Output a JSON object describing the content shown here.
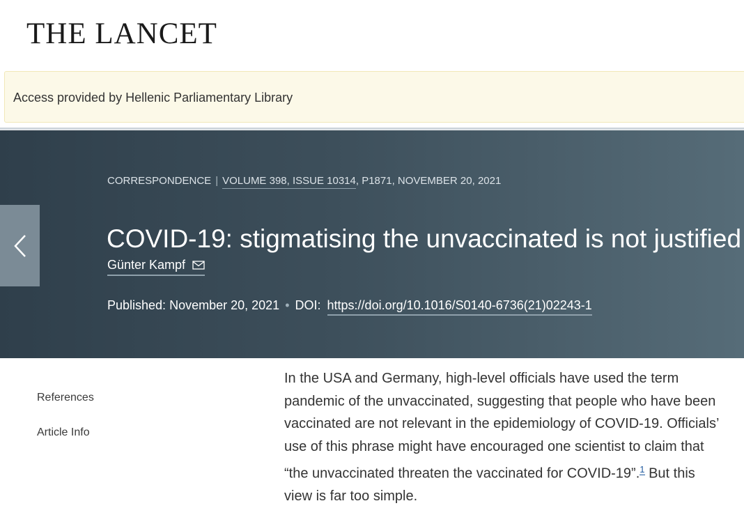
{
  "header": {
    "logo": "THE LANCET"
  },
  "access_banner": {
    "text": "Access provided by Hellenic Parliamentary Library"
  },
  "article": {
    "section": "CORRESPONDENCE",
    "volume_info": "VOLUME 398, ISSUE 10314",
    "page_date": ", P1871, NOVEMBER 20, 2021",
    "title": "COVID-19: stigmatising the unvaccinated is not justified",
    "author": "Günter Kampf",
    "published_label": "Published:",
    "published_date": "November 20, 2021",
    "doi_label": "DOI:",
    "doi_link": "https://doi.org/10.1016/S0140-6736(21)02243-1"
  },
  "sidebar": {
    "items": [
      {
        "label": "References"
      },
      {
        "label": "Article Info"
      }
    ]
  },
  "body": {
    "paragraph": "In the USA and Germany, high-level officials have used the term pandemic of the unvaccinated, suggesting that people who have been vaccinated are not relevant in the epidemiology of COVID-19. Officials’ use of this phrase might have encouraged one scientist to claim that “the unvaccinated threaten the vaccinated for COVID-19”.",
    "reference_marker": "1",
    "paragraph_end": "But this view is far too simple."
  },
  "icons": {
    "back": "chevron-left-icon",
    "author_mail": "envelope-icon"
  },
  "colors": {
    "hero_start": "#2f3f4b",
    "hero_end": "#566c78",
    "banner_bg": "#fcf9e8",
    "link": "#1f5a9e"
  }
}
